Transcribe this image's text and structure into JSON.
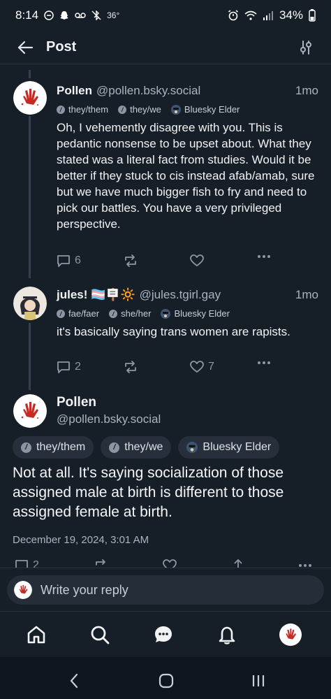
{
  "status_bar": {
    "time": "8:14",
    "temperature": "36°",
    "battery": "34%",
    "icons": [
      "do-not-disturb-icon",
      "snapchat-icon",
      "voicemail-icon",
      "no-bluetooth-icon",
      "alarm-icon",
      "wifi-icon",
      "signal-icon",
      "battery-icon"
    ]
  },
  "header": {
    "title": "Post"
  },
  "colors": {
    "background": "#161e27",
    "text": "#f1f3f5",
    "muted": "#aab4c0",
    "thread_line": "#334052",
    "avatar_red": "#c62a24"
  },
  "posts": [
    {
      "name": "Pollen",
      "handle": "@pollen.bsky.social",
      "time": "1mo",
      "badges": [
        "they/them",
        "they/we",
        "Bluesky Elder"
      ],
      "text": "Oh, I vehemently disagree with you. This is pedantic nonsense to be upset about. What they stated was a literal fact from studies. Would it be better if they stuck to cis instead afab/amab, sure but we have much bigger fish to fry and need to pick our battles. You have a very privileged perspective.",
      "replies": "6",
      "reposts": "",
      "likes": ""
    },
    {
      "name": "jules! 🏳️‍⚧️🪧🔆",
      "handle": "@jules.tgirl.gay",
      "time": "1mo",
      "badges": [
        "fae/faer",
        "she/her",
        "Bluesky Elder"
      ],
      "text": "it's basically saying trans women are rapists.",
      "replies": "2",
      "reposts": "",
      "likes": "7"
    }
  ],
  "main_post": {
    "name": "Pollen",
    "handle": "@pollen.bsky.social",
    "badges": [
      "they/them",
      "they/we",
      "Bluesky Elder"
    ],
    "text": "Not at all. It's saying socialization of those assigned male at birth is different to those assigned female at birth.",
    "timestamp": "December 19, 2024, 3:01 AM",
    "replies": "2"
  },
  "reply_bar": {
    "placeholder": "Write your reply"
  },
  "tabs": [
    "home-tab",
    "search-tab",
    "chat-tab",
    "notifications-tab",
    "profile-tab"
  ],
  "nav": [
    "recents-button",
    "home-button",
    "back-button"
  ]
}
